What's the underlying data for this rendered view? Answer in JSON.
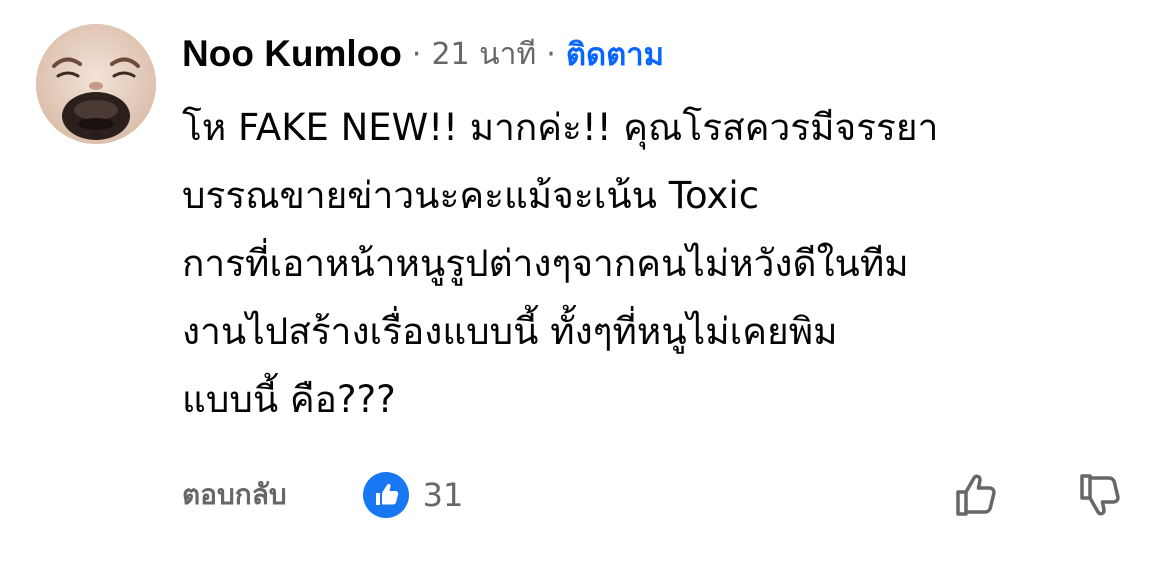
{
  "comment": {
    "author": "Noo Kumloo",
    "separator": "·",
    "time": "21 นาที",
    "follow_label": "ติดตาม",
    "lines": [
      "โห FAKE NEW!! มากค่ะ!! คุณโรสควรมีจรรยา",
      "บรรณขายข่าวนะคะแม้จะเน้น Toxic",
      "การที่เอาหน้าหนูรูปต่างๆจากคนไม่หวังดีในทีม",
      "งานไปสร้างเรื่องแบบนี้ ทั้งๆที่หนูไม่เคยพิม",
      "แบบนี้ คือ???"
    ]
  },
  "actions": {
    "reply_label": "ตอบกลับ",
    "reaction_icon": "like-reaction-icon",
    "reaction_count": "31",
    "upvote_icon": "thumbs-up-outline-icon",
    "downvote_icon": "thumbs-down-outline-icon"
  },
  "colors": {
    "text": "#050505",
    "muted": "#65676b",
    "accent": "#0866ff"
  }
}
